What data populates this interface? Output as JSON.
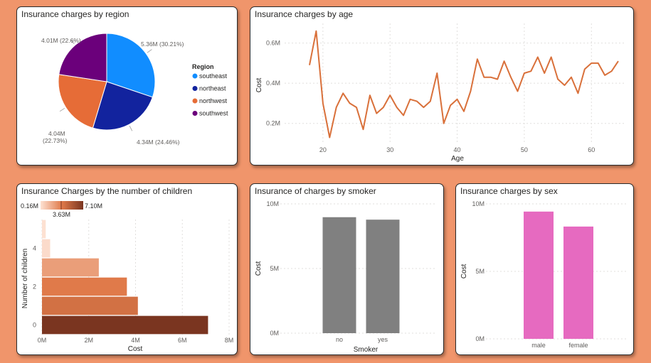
{
  "colors": {
    "page_bg": "#f0956b",
    "southeast": "#118dff",
    "northeast": "#12239e",
    "northwest": "#e66c37",
    "southwest": "#6b007b",
    "age_line": "#d9703a",
    "smoker_bar": "#808080",
    "sex_bar": "#e66ac0",
    "children_min": "#fde1d2",
    "children_max": "#7a3520"
  },
  "cards": {
    "region": {
      "title": "Insurance charges by region"
    },
    "age": {
      "title": "Insurance charges by age"
    },
    "children": {
      "title": "Insurance Charges by the number of children"
    },
    "smoker": {
      "title": "Insurance of charges by smoker"
    },
    "sex": {
      "title": "Insurance charges by sex"
    }
  },
  "chart_data": [
    {
      "id": "region",
      "type": "pie",
      "title": "Insurance charges by region",
      "legend_title": "Region",
      "legend_position": "right",
      "categories": [
        "southeast",
        "northeast",
        "northwest",
        "southwest"
      ],
      "values": [
        5.36,
        4.34,
        4.04,
        4.01
      ],
      "unit": "M",
      "data_labels": [
        "5.36M (30.21%)",
        "4.34M (24.46%)",
        "4.04M (22.73%)",
        "4.01M (22.6%)"
      ]
    },
    {
      "id": "age",
      "type": "line",
      "title": "Insurance charges by age",
      "xlabel": "Age",
      "ylabel": "Cost",
      "x": [
        18,
        19,
        20,
        21,
        22,
        23,
        24,
        25,
        26,
        27,
        28,
        29,
        30,
        31,
        32,
        33,
        34,
        35,
        36,
        37,
        38,
        39,
        40,
        41,
        42,
        43,
        44,
        45,
        46,
        47,
        48,
        49,
        50,
        51,
        52,
        53,
        54,
        55,
        56,
        57,
        58,
        59,
        60,
        61,
        62,
        63,
        64
      ],
      "values": [
        0.49,
        0.66,
        0.3,
        0.13,
        0.28,
        0.35,
        0.3,
        0.28,
        0.17,
        0.34,
        0.25,
        0.28,
        0.34,
        0.28,
        0.24,
        0.32,
        0.31,
        0.28,
        0.31,
        0.45,
        0.2,
        0.29,
        0.32,
        0.26,
        0.36,
        0.52,
        0.43,
        0.43,
        0.42,
        0.51,
        0.43,
        0.36,
        0.45,
        0.46,
        0.53,
        0.45,
        0.53,
        0.42,
        0.39,
        0.43,
        0.35,
        0.47,
        0.5,
        0.5,
        0.44,
        0.46,
        0.51
      ],
      "xticks": [
        "20",
        "30",
        "40",
        "50",
        "60"
      ],
      "yticks": [
        "0.2M",
        "0.4M",
        "0.6M"
      ],
      "xlim": [
        18,
        64
      ],
      "ylim": [
        0.1,
        0.68
      ],
      "grid": true
    },
    {
      "id": "children",
      "type": "bar",
      "orientation": "horizontal",
      "title": "Insurance Charges by the number of children",
      "xlabel": "Cost",
      "ylabel": "Number of children",
      "categories": [
        "0",
        "1",
        "2",
        "3",
        "4",
        "5"
      ],
      "values": [
        7.1,
        4.1,
        3.63,
        2.43,
        0.35,
        0.16
      ],
      "xticks": [
        "0M",
        "2M",
        "4M",
        "6M",
        "8M"
      ],
      "yticks": [
        "0",
        "2",
        "4"
      ],
      "xlim": [
        0,
        8
      ],
      "color_scale": {
        "min_label": "0.16M",
        "mid_label": "3.63M",
        "max_label": "7.10M"
      },
      "grid": true
    },
    {
      "id": "smoker",
      "type": "bar",
      "title": "Insurance of charges by smoker",
      "xlabel": "Smoker",
      "ylabel": "Cost",
      "categories": [
        "no",
        "yes"
      ],
      "values": [
        8.97,
        8.78
      ],
      "yticks": [
        "0M",
        "5M",
        "10M"
      ],
      "ylim": [
        0,
        10
      ],
      "grid": true
    },
    {
      "id": "sex",
      "type": "bar",
      "title": "Insurance charges by sex",
      "ylabel": "Cost",
      "categories": [
        "male",
        "female"
      ],
      "values": [
        9.43,
        8.32
      ],
      "yticks": [
        "0M",
        "5M",
        "10M"
      ],
      "ylim": [
        0,
        10
      ],
      "grid": true
    }
  ]
}
